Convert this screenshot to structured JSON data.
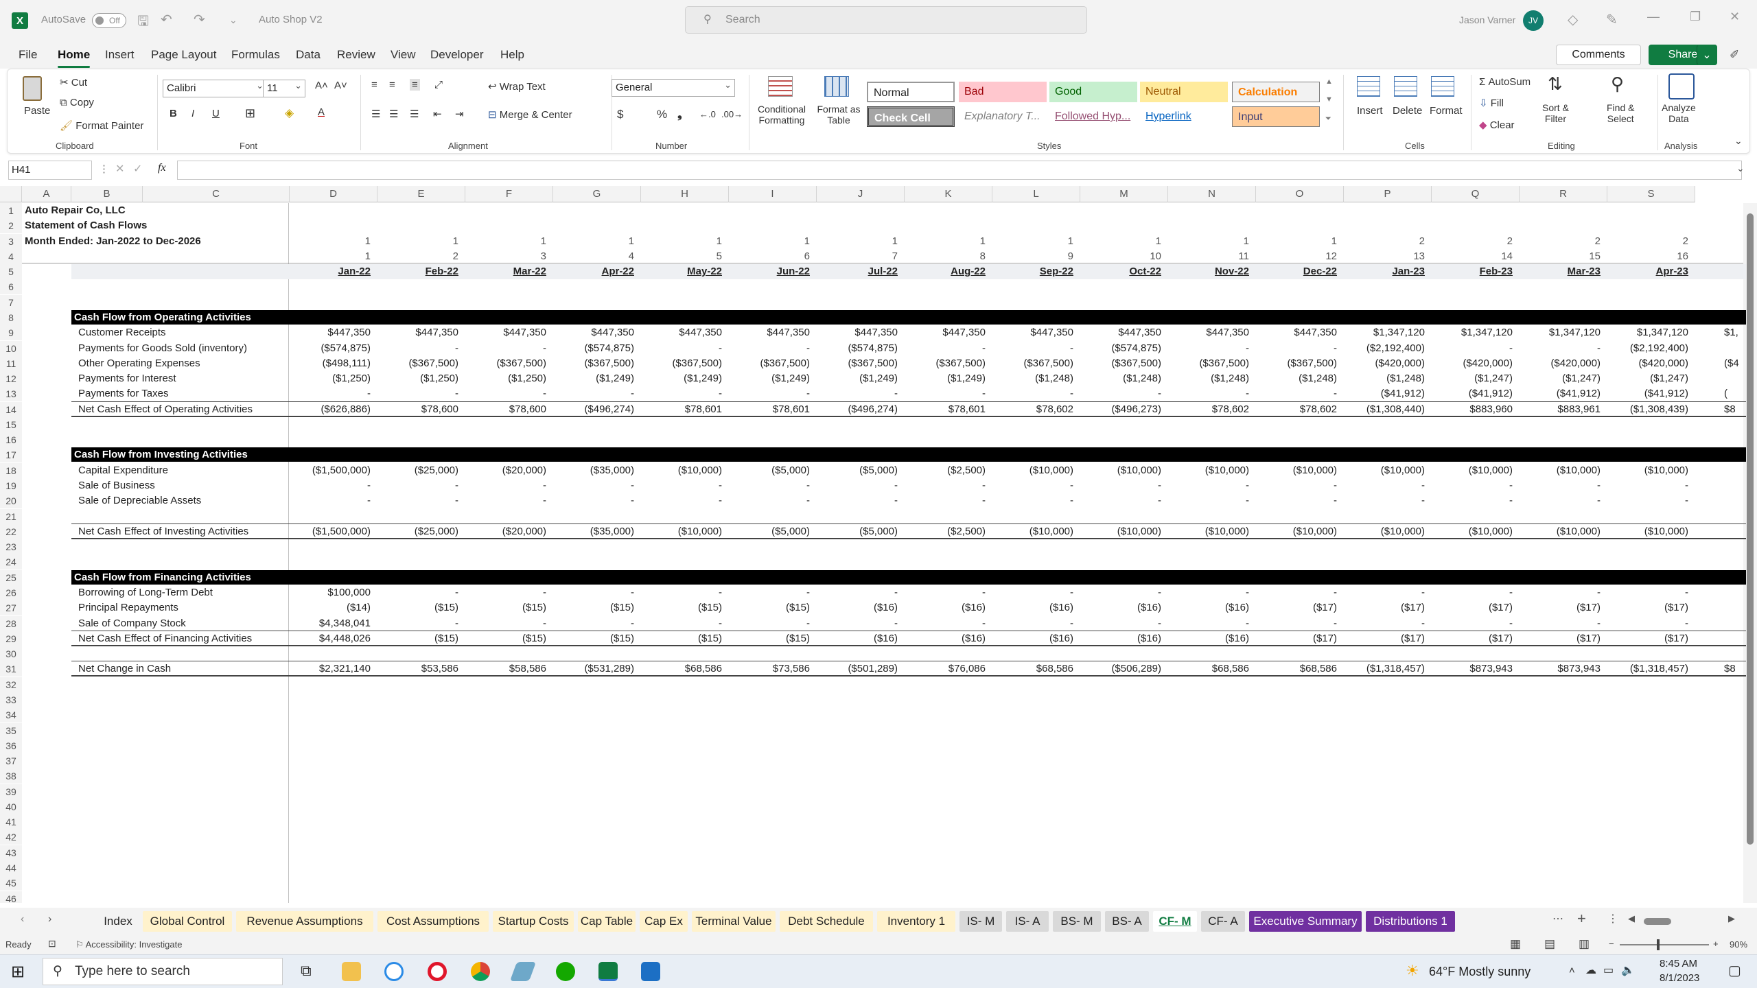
{
  "titlebar": {
    "autosave_label": "AutoSave",
    "autosave_state": "Off",
    "file_name": "Auto Shop V2",
    "search_placeholder": "Search",
    "user_name": "Jason Varner",
    "user_initials": "JV"
  },
  "menu": [
    "File",
    "Home",
    "Insert",
    "Page Layout",
    "Formulas",
    "Data",
    "Review",
    "View",
    "Developer",
    "Help"
  ],
  "menu_active": "Home",
  "top_buttons": {
    "comments": "Comments",
    "share": "Share"
  },
  "ribbon": {
    "clipboard": {
      "paste": "Paste",
      "cut": "Cut",
      "copy": "Copy",
      "format_painter": "Format Painter",
      "group": "Clipboard"
    },
    "font": {
      "name": "Calibri",
      "size": "11",
      "group": "Font"
    },
    "alignment": {
      "wrap_text": "Wrap Text",
      "merge_center": "Merge & Center",
      "group": "Alignment"
    },
    "number": {
      "format": "General",
      "group": "Number"
    },
    "styles": {
      "conditional_1": "Conditional",
      "conditional_2": "Formatting",
      "format_table_1": "Format as",
      "format_table_2": "Table",
      "cells": [
        "Normal",
        "Bad",
        "Good",
        "Neutral",
        "Calculation",
        "Check Cell",
        "Explanatory T...",
        "Followed Hyp...",
        "Hyperlink",
        "Input"
      ],
      "group": "Styles"
    },
    "cells": {
      "insert": "Insert",
      "delete": "Delete",
      "format": "Format",
      "group": "Cells"
    },
    "editing": {
      "autosum": "AutoSum",
      "fill": "Fill",
      "clear": "Clear",
      "sort_1": "Sort &",
      "sort_2": "Filter",
      "find_1": "Find &",
      "find_2": "Select",
      "group": "Editing"
    },
    "analysis": {
      "analyze_1": "Analyze",
      "analyze_2": "Data",
      "group": "Analysis"
    }
  },
  "formula_bar": {
    "name_box": "H41",
    "fx": "fx",
    "content": ""
  },
  "columns": [
    "A",
    "B",
    "C",
    "D",
    "E",
    "F",
    "G",
    "H",
    "I",
    "J",
    "K",
    "L",
    "M",
    "N",
    "O",
    "P",
    "Q",
    "R",
    "S"
  ],
  "row_numbers": [
    "1",
    "2",
    "3",
    "4",
    "5",
    "6",
    "7",
    "8",
    "9",
    "10",
    "11",
    "12",
    "13",
    "14",
    "15",
    "16",
    "17",
    "18",
    "19",
    "20",
    "21",
    "22",
    "23",
    "24",
    "25",
    "26",
    "27",
    "28",
    "29",
    "30",
    "31",
    "32",
    "33",
    "34",
    "35",
    "36",
    "37",
    "38",
    "39",
    "40",
    "41",
    "42",
    "43",
    "44",
    "45",
    "46"
  ],
  "sheet": {
    "company": "Auto Repair Co, LLC",
    "statement": "Statement of Cash Flows",
    "period": "Month Ended: Jan-2022 to Dec-2026",
    "year_row": [
      "1",
      "1",
      "1",
      "1",
      "1",
      "1",
      "1",
      "1",
      "1",
      "1",
      "1",
      "1",
      "2",
      "2",
      "2",
      "2"
    ],
    "month_index_row": [
      "1",
      "2",
      "3",
      "4",
      "5",
      "6",
      "7",
      "8",
      "9",
      "10",
      "11",
      "12",
      "13",
      "14",
      "15",
      "16"
    ],
    "months": [
      "Jan-22",
      "Feb-22",
      "Mar-22",
      "Apr-22",
      "May-22",
      "Jun-22",
      "Jul-22",
      "Aug-22",
      "Sep-22",
      "Oct-22",
      "Nov-22",
      "Dec-22",
      "Jan-23",
      "Feb-23",
      "Mar-23",
      "Apr-23"
    ],
    "operating_header": "Cash Flow from Operating Activities",
    "operating_rows": [
      {
        "label": "Customer Receipts",
        "values": [
          "$447,350",
          "$447,350",
          "$447,350",
          "$447,350",
          "$447,350",
          "$447,350",
          "$447,350",
          "$447,350",
          "$447,350",
          "$447,350",
          "$447,350",
          "$447,350",
          "$1,347,120",
          "$1,347,120",
          "$1,347,120",
          "$1,347,120"
        ],
        "overflow": "$1,"
      },
      {
        "label": "Payments for Goods Sold (inventory)",
        "values": [
          "($574,875)",
          "-",
          "-",
          "($574,875)",
          "-",
          "-",
          "($574,875)",
          "-",
          "-",
          "($574,875)",
          "-",
          "-",
          "($2,192,400)",
          "-",
          "-",
          "($2,192,400)"
        ],
        "overflow": ""
      },
      {
        "label": "Other Operating Expenses",
        "values": [
          "($498,111)",
          "($367,500)",
          "($367,500)",
          "($367,500)",
          "($367,500)",
          "($367,500)",
          "($367,500)",
          "($367,500)",
          "($367,500)",
          "($367,500)",
          "($367,500)",
          "($367,500)",
          "($420,000)",
          "($420,000)",
          "($420,000)",
          "($420,000)"
        ],
        "overflow": "($4"
      },
      {
        "label": "Payments for Interest",
        "values": [
          "($1,250)",
          "($1,250)",
          "($1,250)",
          "($1,249)",
          "($1,249)",
          "($1,249)",
          "($1,249)",
          "($1,249)",
          "($1,248)",
          "($1,248)",
          "($1,248)",
          "($1,248)",
          "($1,248)",
          "($1,247)",
          "($1,247)",
          "($1,247)"
        ],
        "overflow": ""
      },
      {
        "label": "Payments for Taxes",
        "values": [
          "-",
          "-",
          "-",
          "-",
          "-",
          "-",
          "-",
          "-",
          "-",
          "-",
          "-",
          "-",
          "($41,912)",
          "($41,912)",
          "($41,912)",
          "($41,912)"
        ],
        "overflow": "("
      }
    ],
    "operating_net": {
      "label": "Net Cash Effect of Operating Activities",
      "values": [
        "($626,886)",
        "$78,600",
        "$78,600",
        "($496,274)",
        "$78,601",
        "$78,601",
        "($496,274)",
        "$78,601",
        "$78,602",
        "($496,273)",
        "$78,602",
        "$78,602",
        "($1,308,440)",
        "$883,960",
        "$883,961",
        "($1,308,439)"
      ],
      "overflow": "$8"
    },
    "investing_header": "Cash Flow from Investing Activities",
    "investing_rows": [
      {
        "label": "Capital Expenditure",
        "values": [
          "($1,500,000)",
          "($25,000)",
          "($20,000)",
          "($35,000)",
          "($10,000)",
          "($5,000)",
          "($5,000)",
          "($2,500)",
          "($10,000)",
          "($10,000)",
          "($10,000)",
          "($10,000)",
          "($10,000)",
          "($10,000)",
          "($10,000)",
          "($10,000)"
        ]
      },
      {
        "label": "Sale of Business",
        "values": [
          "-",
          "-",
          "-",
          "-",
          "-",
          "-",
          "-",
          "-",
          "-",
          "-",
          "-",
          "-",
          "-",
          "-",
          "-",
          "-"
        ]
      },
      {
        "label": "Sale of Depreciable Assets",
        "values": [
          "-",
          "-",
          "-",
          "-",
          "-",
          "-",
          "-",
          "-",
          "-",
          "-",
          "-",
          "-",
          "-",
          "-",
          "-",
          "-"
        ]
      }
    ],
    "investing_net": {
      "label": "Net Cash Effect of Investing Activities",
      "values": [
        "($1,500,000)",
        "($25,000)",
        "($20,000)",
        "($35,000)",
        "($10,000)",
        "($5,000)",
        "($5,000)",
        "($2,500)",
        "($10,000)",
        "($10,000)",
        "($10,000)",
        "($10,000)",
        "($10,000)",
        "($10,000)",
        "($10,000)",
        "($10,000)"
      ]
    },
    "financing_header": "Cash Flow from Financing Activities",
    "financing_rows": [
      {
        "label": "Borrowing of Long-Term Debt",
        "values": [
          "$100,000",
          "-",
          "-",
          "-",
          "-",
          "-",
          "-",
          "-",
          "-",
          "-",
          "-",
          "-",
          "-",
          "-",
          "-",
          "-"
        ]
      },
      {
        "label": "Principal Repayments",
        "values": [
          "($14)",
          "($15)",
          "($15)",
          "($15)",
          "($15)",
          "($15)",
          "($16)",
          "($16)",
          "($16)",
          "($16)",
          "($16)",
          "($17)",
          "($17)",
          "($17)",
          "($17)",
          "($17)"
        ]
      },
      {
        "label": "Sale of Company Stock",
        "values": [
          "$4,348,041",
          "-",
          "-",
          "-",
          "-",
          "-",
          "-",
          "-",
          "-",
          "-",
          "-",
          "-",
          "-",
          "-",
          "-",
          "-"
        ]
      }
    ],
    "financing_net": {
      "label": "Net Cash Effect of Financing Activities",
      "values": [
        "$4,448,026",
        "($15)",
        "($15)",
        "($15)",
        "($15)",
        "($15)",
        "($16)",
        "($16)",
        "($16)",
        "($16)",
        "($16)",
        "($17)",
        "($17)",
        "($17)",
        "($17)",
        "($17)"
      ]
    },
    "net_change": {
      "label": "Net Change in Cash",
      "values": [
        "$2,321,140",
        "$53,586",
        "$58,586",
        "($531,289)",
        "$68,586",
        "$73,586",
        "($501,289)",
        "$76,086",
        "$68,586",
        "($506,289)",
        "$68,586",
        "$68,586",
        "($1,318,457)",
        "$873,943",
        "$873,943",
        "($1,318,457)"
      ],
      "overflow": "$8"
    }
  },
  "tabs": [
    {
      "label": "Index",
      "style": "plain"
    },
    {
      "label": "Global Control",
      "style": "yellow"
    },
    {
      "label": "Revenue Assumptions",
      "style": "yellow"
    },
    {
      "label": "Cost Assumptions",
      "style": "yellow"
    },
    {
      "label": "Startup Costs",
      "style": "yellow"
    },
    {
      "label": "Cap Table",
      "style": "yellow"
    },
    {
      "label": "Cap Ex",
      "style": "yellow"
    },
    {
      "label": "Terminal Value",
      "style": "yellow"
    },
    {
      "label": "Debt Schedule",
      "style": "yellow"
    },
    {
      "label": "Inventory 1",
      "style": "yellow"
    },
    {
      "label": "IS- M",
      "style": "gray"
    },
    {
      "label": "IS- A",
      "style": "gray"
    },
    {
      "label": "BS- M",
      "style": "gray"
    },
    {
      "label": "BS- A",
      "style": "gray"
    },
    {
      "label": "CF- M",
      "style": "active"
    },
    {
      "label": "CF- A",
      "style": "gray"
    },
    {
      "label": "Executive Summary",
      "style": "purple"
    },
    {
      "label": "Distributions 1",
      "style": "purple"
    }
  ],
  "status": {
    "ready": "Ready",
    "accessibility": "Accessibility: Investigate",
    "zoom": "90%"
  },
  "taskbar": {
    "search_placeholder": "Type here to search",
    "weather": "64°F  Mostly sunny",
    "time": "8:45 AM",
    "date": "8/1/2023"
  }
}
